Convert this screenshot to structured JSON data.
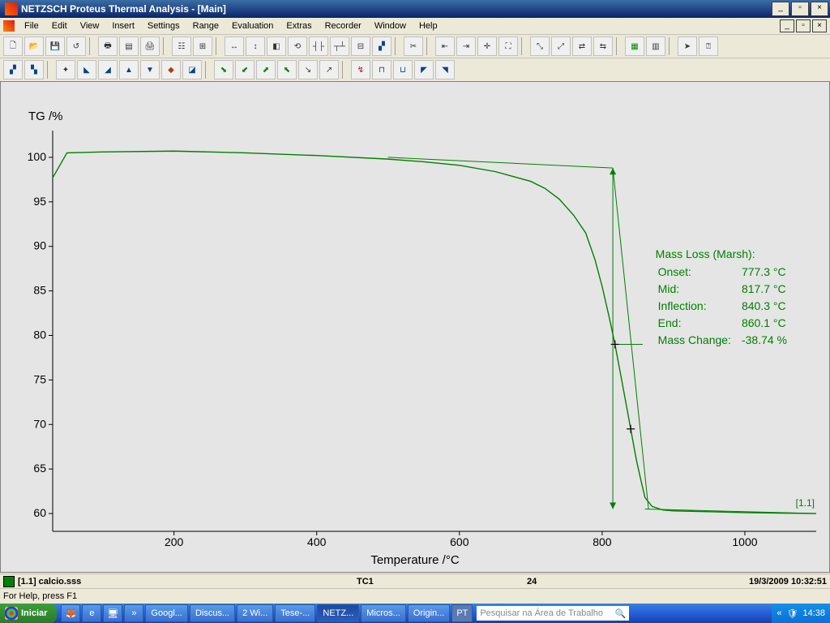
{
  "window": {
    "title": "NETZSCH Proteus Thermal Analysis - [Main]"
  },
  "menu": [
    "File",
    "Edit",
    "View",
    "Insert",
    "Settings",
    "Range",
    "Evaluation",
    "Extras",
    "Recorder",
    "Window",
    "Help"
  ],
  "status": {
    "file": "[1.1] calcio.sss",
    "tc": "TC1",
    "seg": "24",
    "datetime": "19/3/2009 10:32:51",
    "help": "For Help, press F1"
  },
  "taskbar": {
    "start": "Iniciar",
    "items": [
      "Googl...",
      "Discus...",
      "2 Wi...",
      "Tese-...",
      "NETZ...",
      "Micros...",
      "Origin..."
    ],
    "active_index": 4,
    "lang": "PT",
    "search_placeholder": "Pesquisar na Área de Trabalho",
    "clock": "14:38"
  },
  "chart_data": {
    "type": "line",
    "ylabel": "TG /%",
    "xlabel": "Temperature /°C",
    "xlim": [
      30,
      1100
    ],
    "ylim": [
      58,
      103
    ],
    "xticks": [
      200,
      400,
      600,
      800,
      1000
    ],
    "yticks": [
      60,
      65,
      70,
      75,
      80,
      85,
      90,
      95,
      100
    ],
    "series_label": "[1.1]",
    "series": [
      {
        "name": "TG",
        "color": "#008000",
        "x": [
          30,
          50,
          100,
          200,
          300,
          400,
          500,
          550,
          600,
          650,
          700,
          720,
          740,
          760,
          777,
          790,
          800,
          810,
          818,
          825,
          832,
          840,
          848,
          855,
          860,
          870,
          885,
          900,
          950,
          1000,
          1050,
          1100
        ],
        "y": [
          97.7,
          100.5,
          100.6,
          100.7,
          100.5,
          100.2,
          99.8,
          99.5,
          99.1,
          98.4,
          97.3,
          96.5,
          95.3,
          93.5,
          91.5,
          88.5,
          85.5,
          82.0,
          79.0,
          76.0,
          73.0,
          69.5,
          66.0,
          63.5,
          61.8,
          60.8,
          60.4,
          60.3,
          60.2,
          60.1,
          60.05,
          60.0
        ]
      }
    ],
    "tangent_lines": [
      {
        "x1": 500,
        "y1": 100.0,
        "x2": 815,
        "y2": 98.8
      },
      {
        "x1": 815,
        "y1": 98.8,
        "x2": 865,
        "y2": 60.5
      },
      {
        "x1": 860,
        "y1": 60.5,
        "x2": 1100,
        "y2": 60.0
      }
    ],
    "markers": [
      {
        "x": 818,
        "y": 79.0
      },
      {
        "x": 840,
        "y": 69.5
      }
    ],
    "step_arrow": {
      "x": 815,
      "y1": 98.8,
      "y2": 60.5
    },
    "annotation": {
      "title": "Mass Loss (Marsh):",
      "rows": [
        [
          "Onset:",
          "777.3 °C"
        ],
        [
          "Mid:",
          "817.7 °C"
        ],
        [
          "Inflection:",
          "840.3 °C"
        ],
        [
          "End:",
          "860.1 °C"
        ],
        [
          "Mass Change:",
          "-38.74 %"
        ]
      ]
    }
  }
}
